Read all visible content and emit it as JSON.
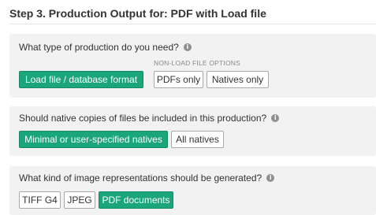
{
  "header": {
    "title": "Step 3. Production Output for: PDF with Load file"
  },
  "production_type": {
    "question": "What type of production do you need?",
    "info_icon": "info-icon",
    "load_option": "Load file / database format",
    "non_load_label": "NON-LOAD FILE OPTIONS",
    "pdfs_only": "PDFs only",
    "natives_only": "Natives only",
    "selected": "Load file / database format"
  },
  "natives": {
    "question": "Should native copies of files be included in this production?",
    "minimal": "Minimal or user-specified natives",
    "all": "All natives",
    "selected": "Minimal or user-specified natives"
  },
  "images": {
    "question": "What kind of image representations should be generated?",
    "tiff": "TIFF G4",
    "jpeg": "JPEG",
    "pdf": "PDF documents",
    "selected": "PDF documents"
  },
  "colors": {
    "selected_bg": "#1aa57a",
    "panel_bg": "#f2f2f2"
  }
}
